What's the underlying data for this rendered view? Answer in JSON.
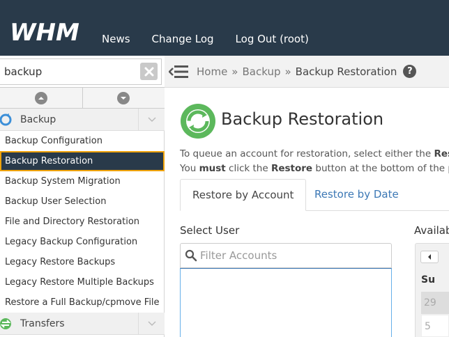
{
  "header": {
    "logo_text": "WHM",
    "nav": [
      "News",
      "Change Log",
      "Log Out (root)"
    ]
  },
  "sidebar": {
    "search_value": "backup",
    "categories": [
      {
        "label": "Backup",
        "icon": "backup-refresh-icon"
      },
      {
        "label": "Transfers",
        "icon": "transfers-icon"
      }
    ],
    "items": [
      "Backup Configuration",
      "Backup Restoration",
      "Backup System Migration",
      "Backup User Selection",
      "File and Directory Restoration",
      "Legacy Backup Configuration",
      "Legacy Restore Backups",
      "Legacy Restore Multiple Backups",
      "Restore a Full Backup/cpmove File"
    ],
    "active_index": 1
  },
  "breadcrumb": {
    "items": [
      "Home",
      "Backup",
      "Backup Restoration"
    ],
    "separator": "»"
  },
  "main": {
    "title": "Backup Restoration",
    "intro_line1_a": "To queue an account for restoration, select either the ",
    "intro_line1_b": "Rest",
    "intro_line2_a": "You ",
    "intro_line2_must": "must",
    "intro_line2_b": " click the ",
    "intro_line2_restore": "Restore",
    "intro_line2_c": " button at the bottom of the pa",
    "tabs": [
      "Restore by Account",
      "Restore by Date"
    ],
    "select_user_label": "Select User",
    "available_label": "Availab",
    "filter_placeholder": "Filter Accounts",
    "calendar": {
      "day_header": "Su",
      "cells": [
        "29",
        "5"
      ]
    }
  },
  "colors": {
    "header_bg": "#293a4a",
    "active_border": "#f0a30a",
    "link": "#3c78b5",
    "green_icon": "#5cb85c"
  }
}
